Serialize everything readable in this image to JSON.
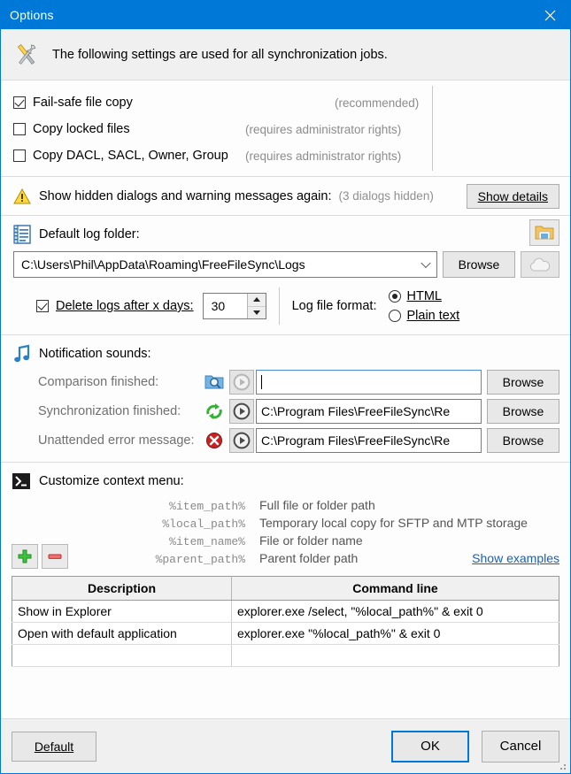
{
  "window": {
    "title": "Options",
    "close_label": "✕"
  },
  "banner": {
    "icon": "tools-icon",
    "text": "The following settings are used for all synchronization jobs."
  },
  "copy_options": {
    "items": [
      {
        "label": "Fail-safe file copy",
        "note": "(recommended)",
        "checked": true
      },
      {
        "label": "Copy locked files",
        "note": "(requires administrator rights)",
        "checked": false
      },
      {
        "label": "Copy DACL, SACL, Owner, Group",
        "note": "(requires administrator rights)",
        "checked": false
      }
    ]
  },
  "hidden_dialogs": {
    "icon": "warning-icon",
    "label": "Show hidden dialogs and warning messages again:",
    "count": "(3 dialogs hidden)",
    "button": "Show details",
    "button_accel": "S"
  },
  "log_folder": {
    "icon": "log-book-icon",
    "label": "Default log folder:",
    "path": "C:\\Users\\Phil\\AppData\\Roaming\\FreeFileSync\\Logs",
    "browse": "Browse",
    "folder_button_icon": "open-folder-icon",
    "cloud_button_icon": "cloud-icon",
    "delete_logs": {
      "checked": true,
      "label": "Delete logs after x days:",
      "accel": "D",
      "value": "30"
    },
    "format": {
      "label": "Log file format:",
      "options": [
        {
          "label": "HTML",
          "accel": "H",
          "selected": true
        },
        {
          "label": "Plain text",
          "accel": "P",
          "selected": false
        }
      ]
    }
  },
  "sounds": {
    "icon": "music-note-icon",
    "title": "Notification sounds:",
    "rows": [
      {
        "label": "Comparison finished:",
        "icon": "compare-folder-icon",
        "play_icon": "play-icon",
        "value": "",
        "focused": true,
        "browse": "Browse"
      },
      {
        "label": "Synchronization finished:",
        "icon": "sync-arrows-icon",
        "play_icon": "play-icon",
        "value": "C:\\Program Files\\FreeFileSync\\Re",
        "focused": false,
        "browse": "Browse"
      },
      {
        "label": "Unattended error message:",
        "icon": "error-cross-icon",
        "play_icon": "play-icon",
        "value": "C:\\Program Files\\FreeFileSync\\Re",
        "focused": false,
        "browse": "Browse"
      }
    ]
  },
  "context_menu": {
    "icon": "terminal-icon",
    "title": "Customize context menu:",
    "variables": [
      {
        "name": "%item_path%",
        "desc": "Full file or folder path"
      },
      {
        "name": "%local_path%",
        "desc": "Temporary local copy for SFTP and MTP storage"
      },
      {
        "name": "%item_name%",
        "desc": "File or folder name"
      },
      {
        "name": "%parent_path%",
        "desc": "Parent folder path"
      }
    ],
    "add_button_icon": "plus-icon",
    "remove_button_icon": "minus-icon",
    "examples_link": "Show examples",
    "table": {
      "headers": [
        "Description",
        "Command line"
      ],
      "rows": [
        [
          "Show in Explorer",
          "explorer.exe /select, \"%local_path%\" & exit 0"
        ],
        [
          "Open with default application",
          "explorer.exe \"%local_path%\" & exit 0"
        ],
        [
          "",
          ""
        ]
      ]
    }
  },
  "footer": {
    "default_button": "Default",
    "default_accel": "D",
    "ok_button": "OK",
    "cancel_button": "Cancel"
  }
}
